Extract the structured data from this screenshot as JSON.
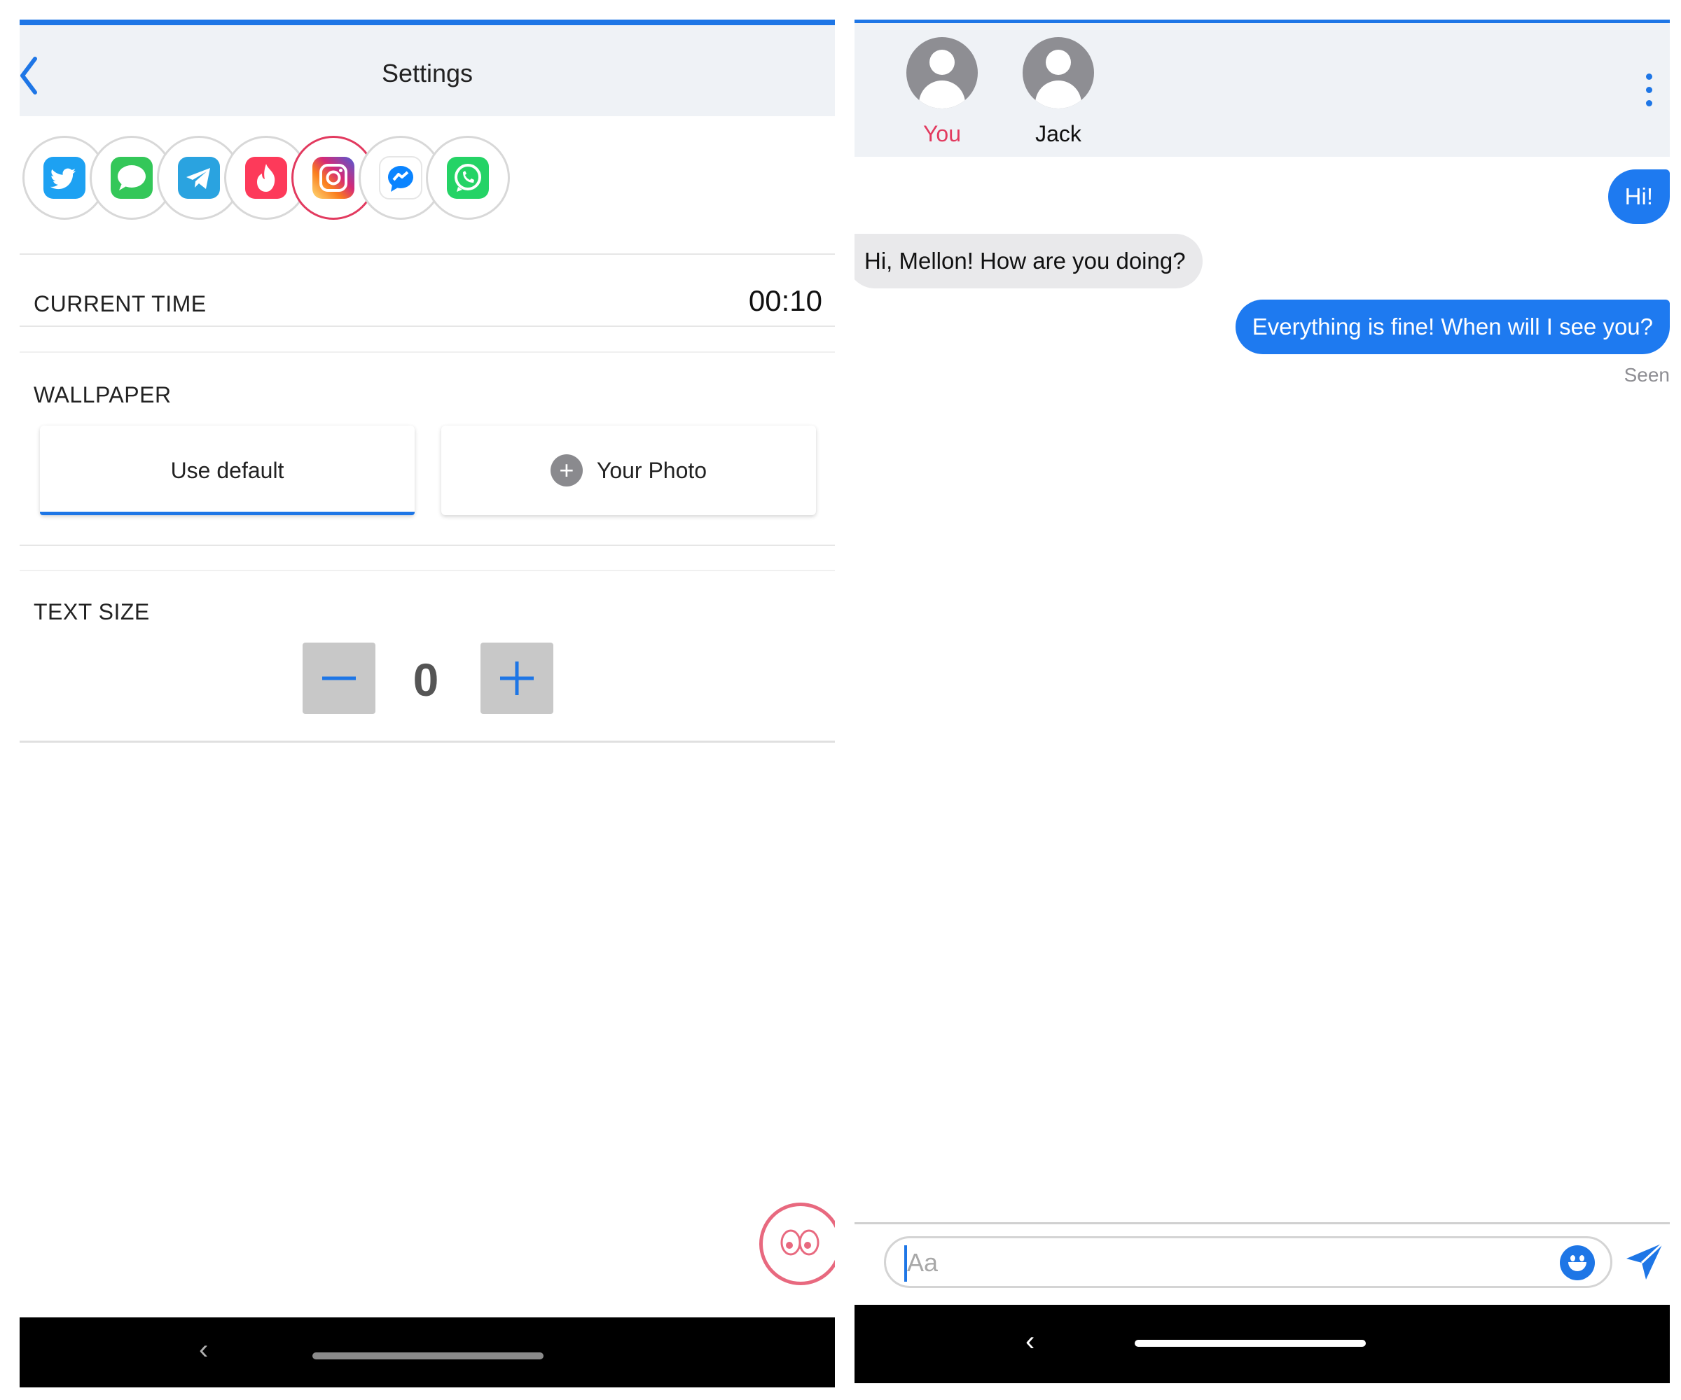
{
  "settings": {
    "title": "Settings",
    "apps": [
      {
        "icon": "twitter-icon",
        "color": "#1da1f2",
        "selected": false
      },
      {
        "icon": "imessage-icon",
        "color": "#34c759",
        "selected": false
      },
      {
        "icon": "telegram-icon",
        "color": "#2aa3e0",
        "selected": false
      },
      {
        "icon": "tinder-icon",
        "color": "#fd3a5a",
        "selected": false
      },
      {
        "icon": "instagram-icon",
        "color": "#c13584",
        "selected": true
      },
      {
        "icon": "messenger-icon",
        "color": "#0a84ff",
        "selected": false
      },
      {
        "icon": "whatsapp-icon",
        "color": "#25d366",
        "selected": false
      }
    ],
    "current_time_label": "CURRENT TIME",
    "current_time_value": "00:10",
    "wallpaper_label": "WALLPAPER",
    "use_default_label": "Use default",
    "your_photo_label": "Your Photo",
    "text_size_label": "TEXT SIZE",
    "text_size_value": "0"
  },
  "chat": {
    "participants": [
      {
        "name": "You",
        "color": "#e23a5f"
      },
      {
        "name": "Jack",
        "color": "#111111"
      }
    ],
    "messages": [
      {
        "text": "Hi!",
        "direction": "out"
      },
      {
        "text": "Hi, Mellon! How are you doing?",
        "direction": "in"
      },
      {
        "text": "Everything is fine! When will I see you?",
        "direction": "out"
      }
    ],
    "seen_label": "Seen",
    "input_placeholder": "Aa"
  },
  "colors": {
    "accent": "#1e76e6",
    "highlight": "#e23a5f"
  }
}
